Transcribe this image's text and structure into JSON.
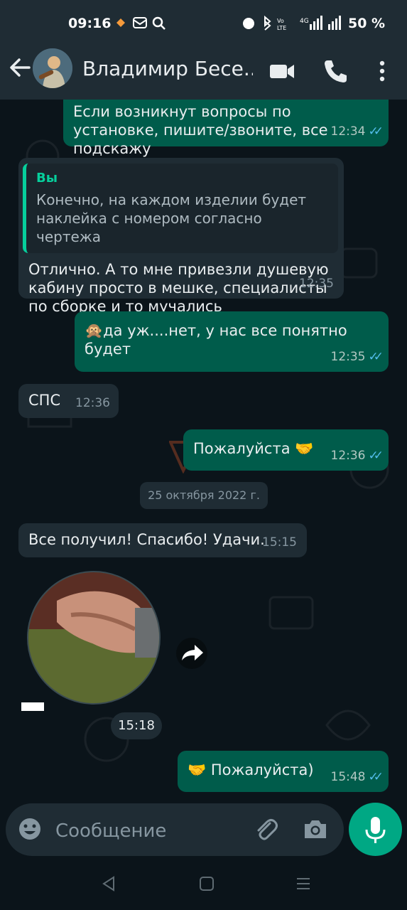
{
  "status_bar": {
    "time": "09:16",
    "battery": "50 %"
  },
  "header": {
    "contact_name": "Владимир Бесе..."
  },
  "messages": [
    {
      "dir": "out",
      "text": "Если возникнут вопросы по установке, пишите/звоните, все подскажу",
      "time": "12:34"
    },
    {
      "dir": "in",
      "quote_author": "Вы",
      "quote_text": "Конечно, на каждом изделии будет наклейка с номером согласно чертежа",
      "text": "Отлично. А то мне привезли душевую кабину просто в мешке, специалисты по сборке и то мучались",
      "time": "12:35"
    },
    {
      "dir": "out",
      "text": "🙊да уж....нет, у нас все понятно будет",
      "time": "12:35"
    },
    {
      "dir": "in",
      "text": "СПС",
      "time": "12:36"
    },
    {
      "dir": "out",
      "text": "Пожалуйста 🤝",
      "time": "12:36"
    },
    {
      "dir": "in",
      "text": "Все получил! Спасибо! Удачи.",
      "time": "15:15"
    },
    {
      "dir": "out",
      "text": "🤝 Пожалуйста)",
      "time": "15:48"
    }
  ],
  "date_separator": "25 октября 2022 г.",
  "video_note": {
    "time": "15:18"
  },
  "composer": {
    "placeholder": "Сообщение"
  },
  "colors": {
    "outgoing_bubble": "#005c4b",
    "incoming_bubble": "#1f2c34",
    "accent": "#00a884",
    "read_tick": "#53bdeb"
  },
  "icons": {
    "back": "arrow-left-icon",
    "video_call": "video-camera-icon",
    "voice_call": "phone-icon",
    "menu": "more-vertical-icon",
    "emoji": "emoji-icon",
    "attach": "paperclip-icon",
    "camera": "camera-icon",
    "mic": "microphone-icon",
    "forward": "forward-icon"
  }
}
